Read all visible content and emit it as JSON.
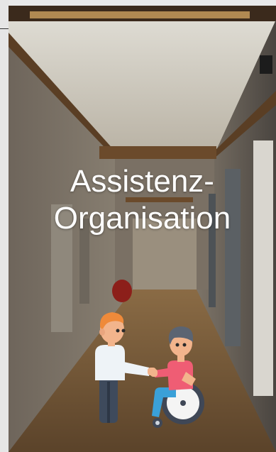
{
  "hero": {
    "title_line1": "Assistenz-",
    "title_line2": "Organisation",
    "title_color": "#ffffff",
    "background_icon": "hallway-photo",
    "illustration_icon": "assistance-handshake-wheelchair-icon"
  }
}
